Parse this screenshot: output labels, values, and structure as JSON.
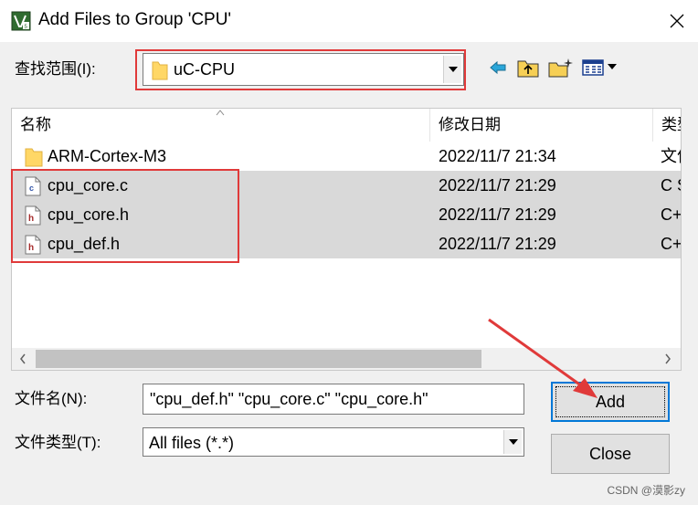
{
  "window": {
    "title": "Add Files to Group 'CPU'",
    "app_icon": "keil-uvision-icon",
    "close_glyph": "✕"
  },
  "look_in": {
    "label": "查找范围(I):",
    "value": "uC-CPU",
    "toolbar_icons": [
      "back-arrow-icon",
      "up-folder-icon",
      "new-folder-icon",
      "view-menu-icon"
    ]
  },
  "list": {
    "columns": [
      "名称",
      "修改日期",
      "类型"
    ],
    "rows": [
      {
        "name": "ARM-Cortex-M3",
        "date": "2022/11/7 21:34",
        "type": "文件",
        "icon": "folder-icon",
        "selected": false
      },
      {
        "name": "cpu_core.c",
        "date": "2022/11/7 21:29",
        "type": "C Source",
        "icon": "c-source-file-icon",
        "selected": true
      },
      {
        "name": "cpu_core.h",
        "date": "2022/11/7 21:29",
        "type": "C+",
        "icon": "header-file-icon",
        "selected": true
      },
      {
        "name": "cpu_def.h",
        "date": "2022/11/7 21:29",
        "type": "C+",
        "icon": "header-file-icon",
        "selected": true
      }
    ]
  },
  "file_name": {
    "label": "文件名(N):",
    "value": "\"cpu_def.h\" \"cpu_core.c\" \"cpu_core.h\""
  },
  "file_type": {
    "label": "文件类型(T):",
    "value": "All files (*.*)"
  },
  "buttons": {
    "add": "Add",
    "close": "Close"
  },
  "watermark": "CSDN @漠影zy",
  "colors": {
    "annotation_red": "#e03a3a",
    "selection": "#d9d9d9",
    "dialog_bg": "#f0f0f0"
  }
}
